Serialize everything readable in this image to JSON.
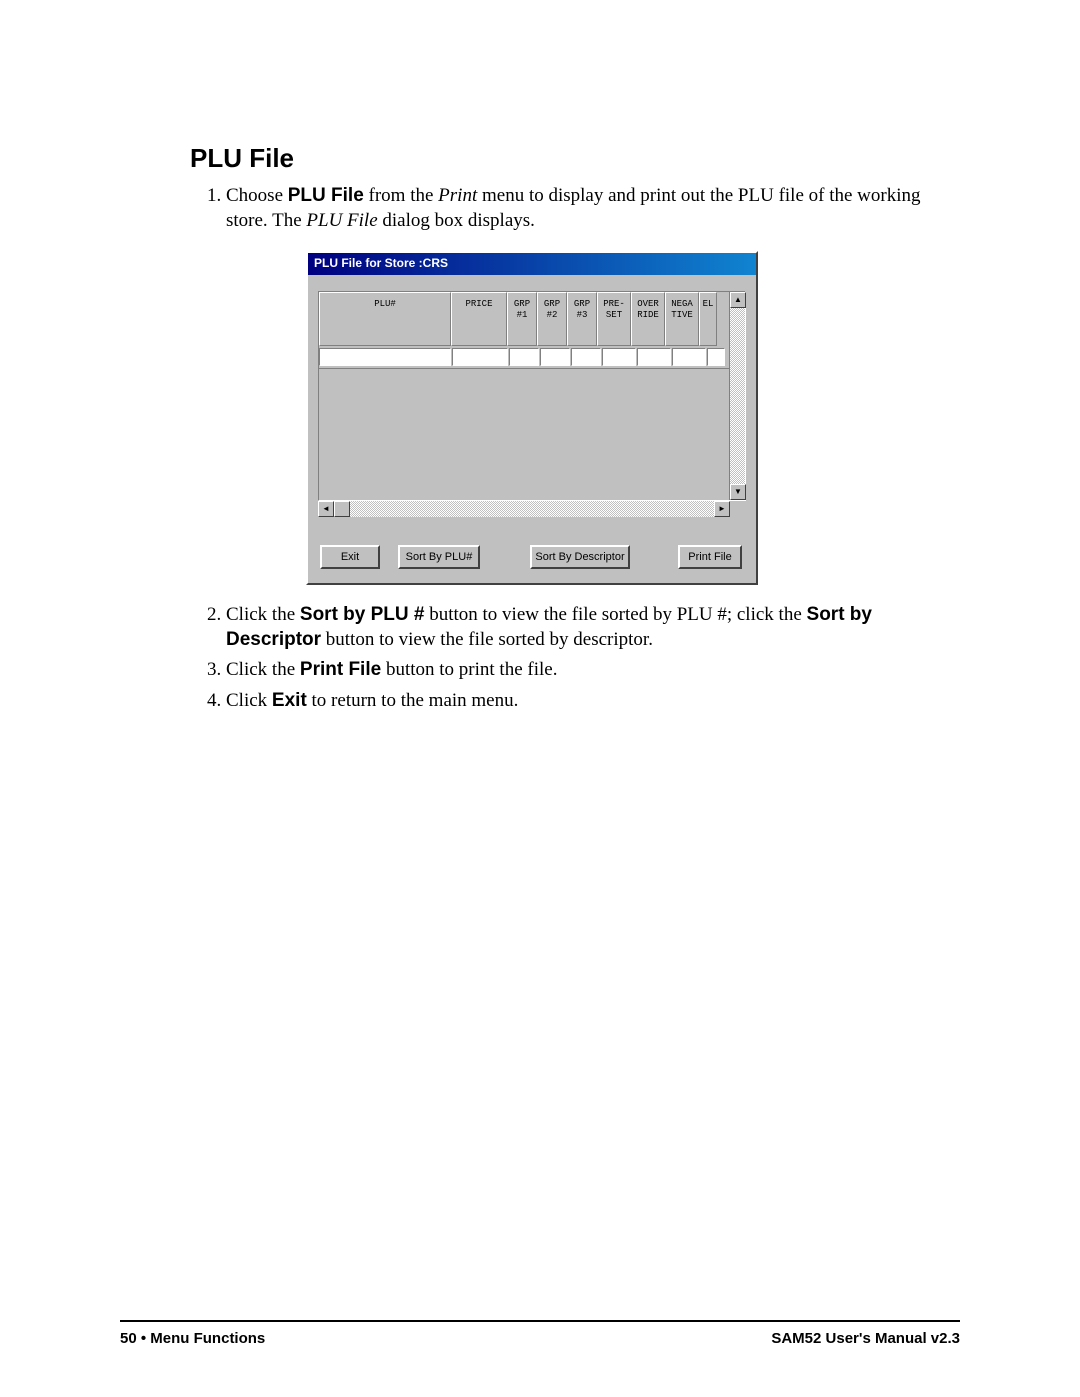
{
  "heading": "PLU File",
  "steps": {
    "s1a": "Choose ",
    "s1b": "PLU File",
    "s1c": " from the ",
    "s1d": "Print",
    "s1e": " menu to display and print out the PLU file of the working store.  The ",
    "s1f": "PLU File",
    "s1g": " dialog box displays.",
    "s2a": "Click the ",
    "s2b": "Sort by PLU #",
    "s2c": " button to view the file sorted by PLU #; click the ",
    "s2d": "Sort by Descriptor",
    "s2e": " button to view the file sorted by descriptor.",
    "s3a": "Click the ",
    "s3b": "Print File",
    "s3c": " button to print the file.",
    "s4a": "Click ",
    "s4b": "Exit",
    "s4c": " to return to the main menu."
  },
  "dialog": {
    "title": "PLU File for Store :CRS",
    "columns": {
      "c0": "PLU#",
      "c1": "PRICE",
      "c2": "GRP\n#1",
      "c3": "GRP\n#2",
      "c4": "GRP\n#3",
      "c5": "PRE-\nSET",
      "c6": "OVER\nRIDE",
      "c7": "NEGA\nTIVE",
      "c8": "EL"
    },
    "buttons": {
      "exit": "Exit",
      "sort_plu": "Sort By PLU#",
      "sort_desc": "Sort By Descriptor",
      "print": "Print File"
    }
  },
  "footer": {
    "left_page": "50",
    "left_sep": "  •  ",
    "left_section": "Menu Functions",
    "right": "SAM52 User's Manual v2.3"
  }
}
